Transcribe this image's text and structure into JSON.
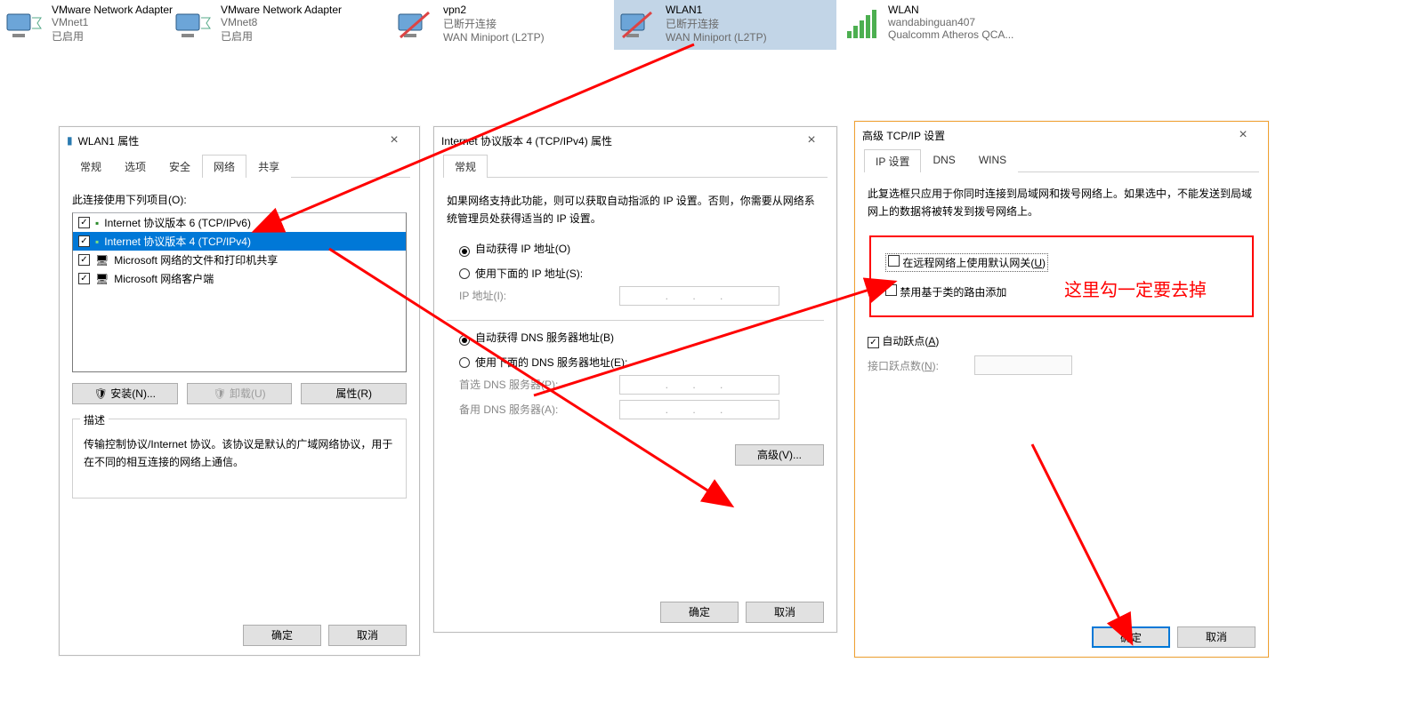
{
  "adapters": [
    {
      "title": "VMware Network Adapter",
      "l2": "VMnet1",
      "l3": "已启用"
    },
    {
      "title": "VMware Network Adapter",
      "l2": "VMnet8",
      "l3": "已启用"
    },
    {
      "title": "vpn2",
      "l2": "已断开连接",
      "l3": "WAN Miniport (L2TP)"
    },
    {
      "title": "WLAN1",
      "l2": "已断开连接",
      "l3": "WAN Miniport (L2TP)",
      "selected": true
    },
    {
      "title": "WLAN",
      "l2": "wandabinguan407",
      "l3": "Qualcomm Atheros QCA..."
    }
  ],
  "dlg1": {
    "title": "WLAN1 属性",
    "tabs": [
      "常规",
      "选项",
      "安全",
      "网络",
      "共享"
    ],
    "active_tab": 3,
    "list_label": "此连接使用下列项目(O):",
    "items": [
      "Internet 协议版本 6 (TCP/IPv6)",
      "Internet 协议版本 4 (TCP/IPv4)",
      "Microsoft 网络的文件和打印机共享",
      "Microsoft 网络客户端"
    ],
    "install": "安装(N)...",
    "uninstall": "卸载(U)",
    "props": "属性(R)",
    "desc_title": "描述",
    "desc": "传输控制协议/Internet 协议。该协议是默认的广域网络协议，用于在不同的相互连接的网络上通信。",
    "ok": "确定",
    "cancel": "取消"
  },
  "dlg2": {
    "title": "Internet 协议版本 4 (TCP/IPv4) 属性",
    "tab": "常规",
    "intro": "如果网络支持此功能，则可以获取自动指派的 IP 设置。否则，你需要从网络系统管理员处获得适当的 IP 设置。",
    "r1": "自动获得 IP 地址(O)",
    "r2": "使用下面的 IP 地址(S):",
    "ip_label": "IP 地址(I):",
    "r3": "自动获得 DNS 服务器地址(B)",
    "r4": "使用下面的 DNS 服务器地址(E):",
    "dns1": "首选 DNS 服务器(P):",
    "dns2": "备用 DNS 服务器(A):",
    "dotmask": ".   .   .",
    "adv": "高级(V)...",
    "ok": "确定",
    "cancel": "取消"
  },
  "dlg3": {
    "title": "高级 TCP/IP 设置",
    "tabs": [
      "IP 设置",
      "DNS",
      "WINS"
    ],
    "intro": "此复选框只应用于你同时连接到局域网和拨号网络上。如果选中，不能发送到局域网上的数据将被转发到拨号网络上。",
    "c1_pre": "在远程网络上使用默认网关(",
    "c1_u": "U",
    "c1_post": ")",
    "c2": "禁用基于类的路由添加",
    "c3_pre": "自动跃点(",
    "c3_u": "A",
    "c3_post": ")",
    "hop_pre": "接口跃点数(",
    "hop_u": "N",
    "hop_post": "):",
    "ok": "确定",
    "cancel": "取消"
  },
  "annotation": "这里勾一定要去掉"
}
